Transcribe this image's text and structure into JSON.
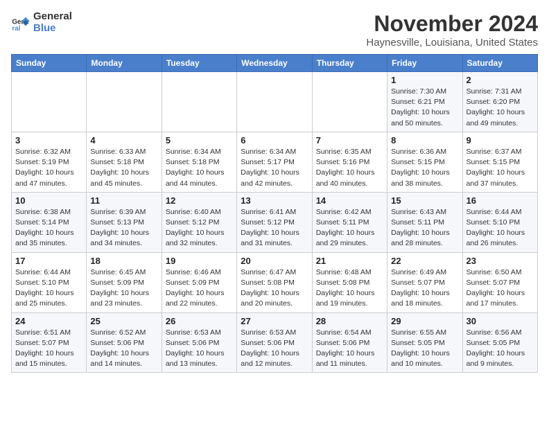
{
  "logo": {
    "line1": "General",
    "line2": "Blue"
  },
  "title": "November 2024",
  "location": "Haynesville, Louisiana, United States",
  "days_of_week": [
    "Sunday",
    "Monday",
    "Tuesday",
    "Wednesday",
    "Thursday",
    "Friday",
    "Saturday"
  ],
  "weeks": [
    [
      {
        "day": "",
        "info": ""
      },
      {
        "day": "",
        "info": ""
      },
      {
        "day": "",
        "info": ""
      },
      {
        "day": "",
        "info": ""
      },
      {
        "day": "",
        "info": ""
      },
      {
        "day": "1",
        "info": "Sunrise: 7:30 AM\nSunset: 6:21 PM\nDaylight: 10 hours\nand 50 minutes."
      },
      {
        "day": "2",
        "info": "Sunrise: 7:31 AM\nSunset: 6:20 PM\nDaylight: 10 hours\nand 49 minutes."
      }
    ],
    [
      {
        "day": "3",
        "info": "Sunrise: 6:32 AM\nSunset: 5:19 PM\nDaylight: 10 hours\nand 47 minutes."
      },
      {
        "day": "4",
        "info": "Sunrise: 6:33 AM\nSunset: 5:18 PM\nDaylight: 10 hours\nand 45 minutes."
      },
      {
        "day": "5",
        "info": "Sunrise: 6:34 AM\nSunset: 5:18 PM\nDaylight: 10 hours\nand 44 minutes."
      },
      {
        "day": "6",
        "info": "Sunrise: 6:34 AM\nSunset: 5:17 PM\nDaylight: 10 hours\nand 42 minutes."
      },
      {
        "day": "7",
        "info": "Sunrise: 6:35 AM\nSunset: 5:16 PM\nDaylight: 10 hours\nand 40 minutes."
      },
      {
        "day": "8",
        "info": "Sunrise: 6:36 AM\nSunset: 5:15 PM\nDaylight: 10 hours\nand 38 minutes."
      },
      {
        "day": "9",
        "info": "Sunrise: 6:37 AM\nSunset: 5:15 PM\nDaylight: 10 hours\nand 37 minutes."
      }
    ],
    [
      {
        "day": "10",
        "info": "Sunrise: 6:38 AM\nSunset: 5:14 PM\nDaylight: 10 hours\nand 35 minutes."
      },
      {
        "day": "11",
        "info": "Sunrise: 6:39 AM\nSunset: 5:13 PM\nDaylight: 10 hours\nand 34 minutes."
      },
      {
        "day": "12",
        "info": "Sunrise: 6:40 AM\nSunset: 5:12 PM\nDaylight: 10 hours\nand 32 minutes."
      },
      {
        "day": "13",
        "info": "Sunrise: 6:41 AM\nSunset: 5:12 PM\nDaylight: 10 hours\nand 31 minutes."
      },
      {
        "day": "14",
        "info": "Sunrise: 6:42 AM\nSunset: 5:11 PM\nDaylight: 10 hours\nand 29 minutes."
      },
      {
        "day": "15",
        "info": "Sunrise: 6:43 AM\nSunset: 5:11 PM\nDaylight: 10 hours\nand 28 minutes."
      },
      {
        "day": "16",
        "info": "Sunrise: 6:44 AM\nSunset: 5:10 PM\nDaylight: 10 hours\nand 26 minutes."
      }
    ],
    [
      {
        "day": "17",
        "info": "Sunrise: 6:44 AM\nSunset: 5:10 PM\nDaylight: 10 hours\nand 25 minutes."
      },
      {
        "day": "18",
        "info": "Sunrise: 6:45 AM\nSunset: 5:09 PM\nDaylight: 10 hours\nand 23 minutes."
      },
      {
        "day": "19",
        "info": "Sunrise: 6:46 AM\nSunset: 5:09 PM\nDaylight: 10 hours\nand 22 minutes."
      },
      {
        "day": "20",
        "info": "Sunrise: 6:47 AM\nSunset: 5:08 PM\nDaylight: 10 hours\nand 20 minutes."
      },
      {
        "day": "21",
        "info": "Sunrise: 6:48 AM\nSunset: 5:08 PM\nDaylight: 10 hours\nand 19 minutes."
      },
      {
        "day": "22",
        "info": "Sunrise: 6:49 AM\nSunset: 5:07 PM\nDaylight: 10 hours\nand 18 minutes."
      },
      {
        "day": "23",
        "info": "Sunrise: 6:50 AM\nSunset: 5:07 PM\nDaylight: 10 hours\nand 17 minutes."
      }
    ],
    [
      {
        "day": "24",
        "info": "Sunrise: 6:51 AM\nSunset: 5:07 PM\nDaylight: 10 hours\nand 15 minutes."
      },
      {
        "day": "25",
        "info": "Sunrise: 6:52 AM\nSunset: 5:06 PM\nDaylight: 10 hours\nand 14 minutes."
      },
      {
        "day": "26",
        "info": "Sunrise: 6:53 AM\nSunset: 5:06 PM\nDaylight: 10 hours\nand 13 minutes."
      },
      {
        "day": "27",
        "info": "Sunrise: 6:53 AM\nSunset: 5:06 PM\nDaylight: 10 hours\nand 12 minutes."
      },
      {
        "day": "28",
        "info": "Sunrise: 6:54 AM\nSunset: 5:06 PM\nDaylight: 10 hours\nand 11 minutes."
      },
      {
        "day": "29",
        "info": "Sunrise: 6:55 AM\nSunset: 5:05 PM\nDaylight: 10 hours\nand 10 minutes."
      },
      {
        "day": "30",
        "info": "Sunrise: 6:56 AM\nSunset: 5:05 PM\nDaylight: 10 hours\nand 9 minutes."
      }
    ]
  ]
}
